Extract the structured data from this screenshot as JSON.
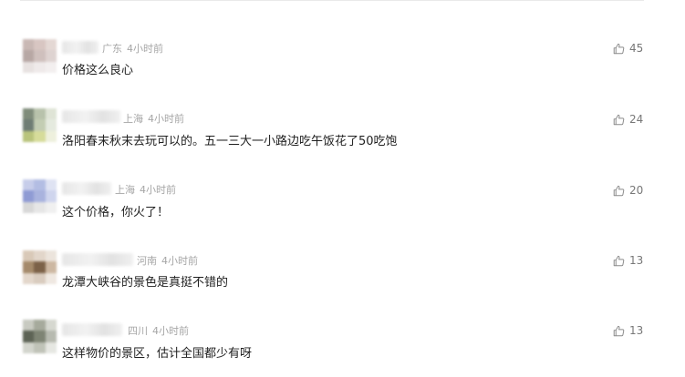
{
  "comments": [
    {
      "location": "广东",
      "time": "4小时前",
      "text": "价格这么良心",
      "likes": "45"
    },
    {
      "location": "上海",
      "time": "4小时前",
      "text": "洛阳春末秋末去玩可以的。五一三大一小路边吃午饭花了50吃饱",
      "likes": "24"
    },
    {
      "location": "上海",
      "time": "4小时前",
      "text": "这个价格，你火了！",
      "likes": "20"
    },
    {
      "location": "河南",
      "time": "4小时前",
      "text": "龙潭大峡谷的景色是真挺不错的",
      "likes": "13"
    },
    {
      "location": "四川",
      "time": "4小时前",
      "text": "这样物价的景区，估计全国都少有呀",
      "likes": "13"
    }
  ],
  "icons": {
    "like": "thumbs-up-icon"
  },
  "colors": {
    "meta_text": "#a6a6a6",
    "like_count": "#777777",
    "comment_text": "#1f1f1f"
  }
}
